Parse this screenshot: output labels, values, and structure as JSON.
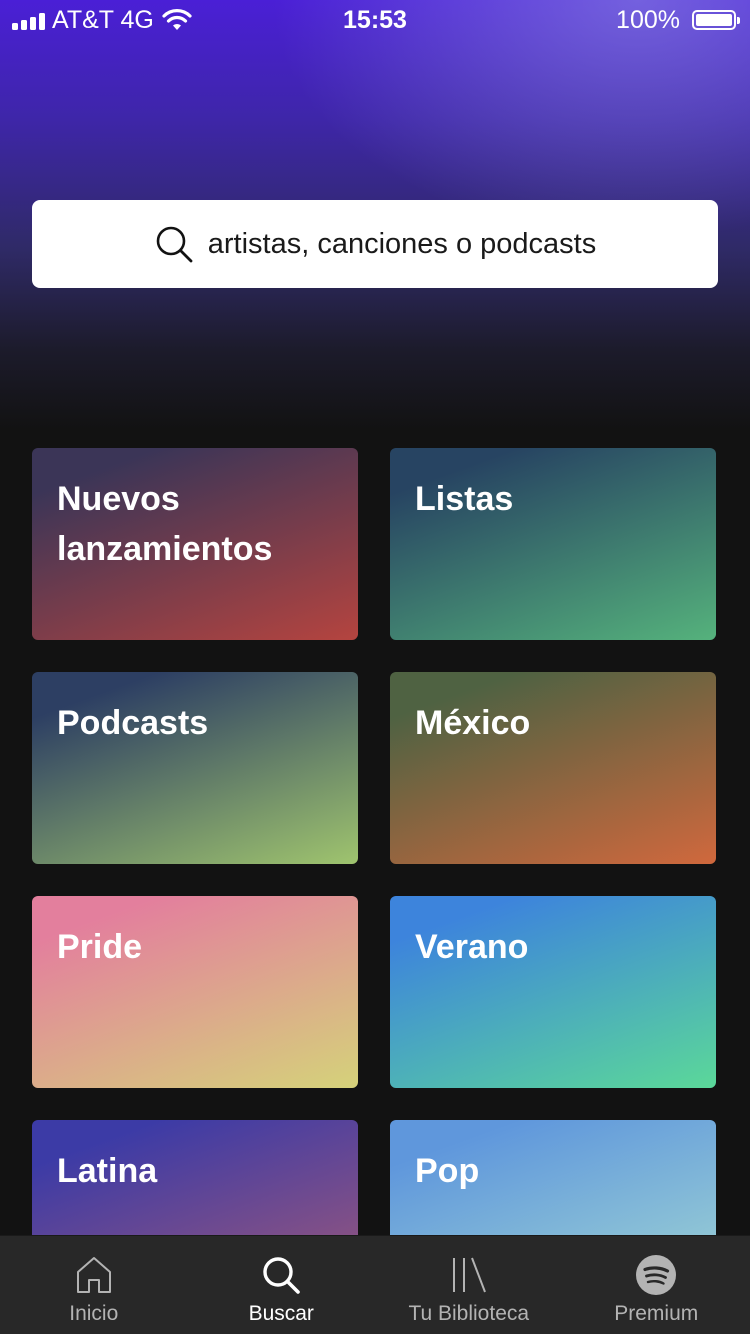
{
  "status_bar": {
    "carrier": "AT&T 4G",
    "time": "15:53",
    "battery": "100%"
  },
  "search": {
    "placeholder": "artistas, canciones o podcasts",
    "icon": "search-icon"
  },
  "categories": [
    {
      "label": "Nuevos lanzamientos",
      "colors": [
        "#3b3557",
        "#b5443f"
      ]
    },
    {
      "label": "Listas",
      "colors": [
        "#274462",
        "#55b27c"
      ]
    },
    {
      "label": "Podcasts",
      "colors": [
        "#2d3f63",
        "#9fc46e"
      ]
    },
    {
      "label": "México",
      "colors": [
        "#4f6242",
        "#d0683d"
      ]
    },
    {
      "label": "Pride",
      "colors": [
        "#e37f9d",
        "#d5d27a"
      ]
    },
    {
      "label": "Verano",
      "colors": [
        "#3d84dc",
        "#5bd899"
      ]
    },
    {
      "label": "Latina",
      "colors": [
        "#3c3ba6",
        "#a35a78"
      ]
    },
    {
      "label": "Pop",
      "colors": [
        "#5f97dc",
        "#a3d8d3"
      ]
    }
  ],
  "tabs": [
    {
      "label": "Inicio",
      "icon": "home-icon"
    },
    {
      "label": "Buscar",
      "icon": "search-icon",
      "active": true
    },
    {
      "label": "Tu Biblioteca",
      "icon": "library-icon"
    },
    {
      "label": "Premium",
      "icon": "spotify-icon"
    }
  ],
  "colors": {
    "background": "#121212",
    "tabbar": "#282828",
    "hero_top": "#4a1fd6"
  }
}
